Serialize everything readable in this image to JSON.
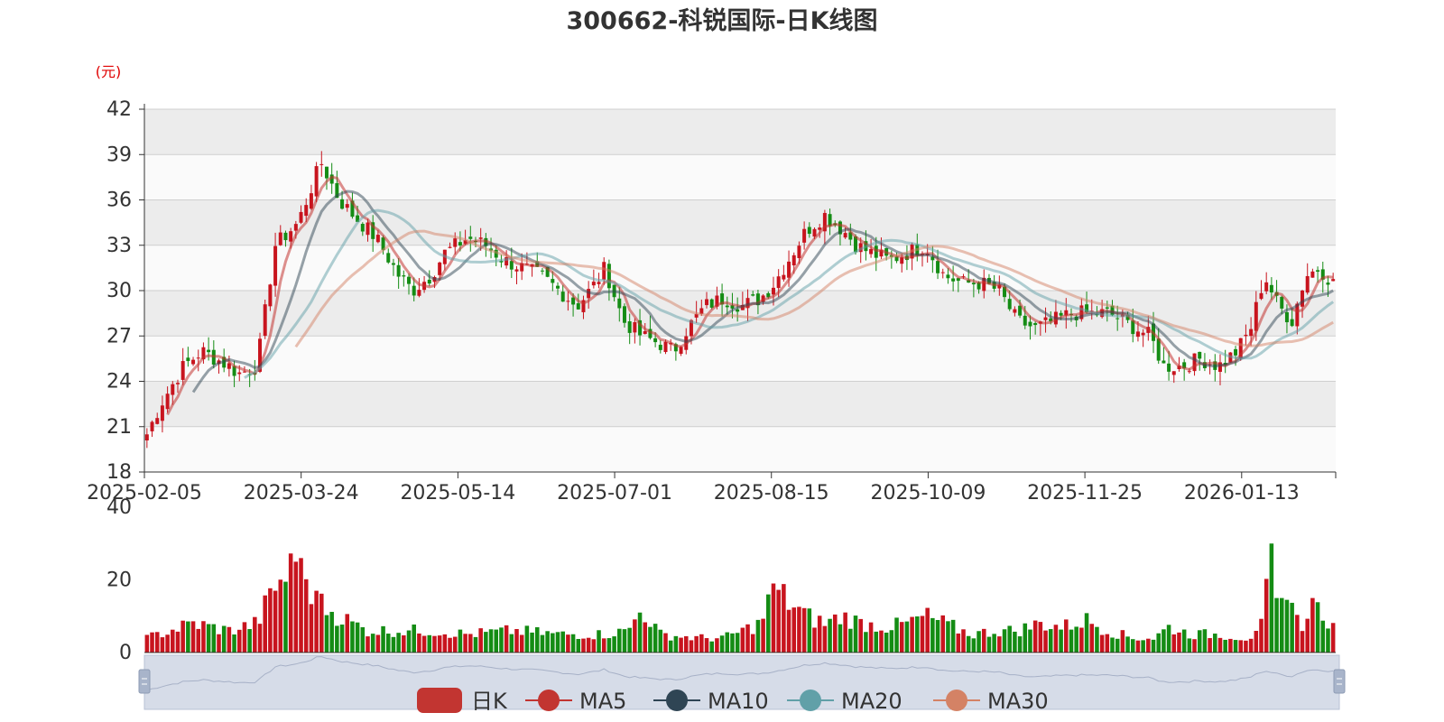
{
  "chart_data": {
    "type": "candlestick",
    "title": "300662-科锐国际-日K线图",
    "unit_label": "(元)",
    "price_axis": {
      "min": 18,
      "max": 42,
      "ticks": [
        18,
        21,
        24,
        27,
        30,
        33,
        36,
        39,
        42
      ]
    },
    "volume_axis": {
      "min": 0,
      "max": 40,
      "ticks": [
        0,
        20,
        40
      ]
    },
    "x_tick_labels": [
      "2025-02-05",
      "2025-03-24",
      "2025-05-14",
      "2025-07-01",
      "2025-08-15",
      "2025-10-09",
      "2025-11-25",
      "2026-01-13"
    ],
    "candle_count": 232,
    "price_keyframes": [
      [
        0,
        20.5
      ],
      [
        3,
        22.5
      ],
      [
        8,
        25.0
      ],
      [
        12,
        26.0
      ],
      [
        18,
        25.0
      ],
      [
        20,
        24.5
      ],
      [
        24,
        25.0
      ],
      [
        28,
        33.0
      ],
      [
        33,
        34.5
      ],
      [
        38,
        38.5
      ],
      [
        42,
        36.0
      ],
      [
        45,
        35.0
      ],
      [
        50,
        33.5
      ],
      [
        55,
        31.0
      ],
      [
        58,
        30.0
      ],
      [
        62,
        31.0
      ],
      [
        65,
        32.5
      ],
      [
        70,
        33.5
      ],
      [
        74,
        33.0
      ],
      [
        78,
        32.0
      ],
      [
        82,
        31.5
      ],
      [
        86,
        31.0
      ],
      [
        90,
        30.0
      ],
      [
        94,
        29.0
      ],
      [
        98,
        30.5
      ],
      [
        100,
        31.5
      ],
      [
        104,
        28.0
      ],
      [
        108,
        27.0
      ],
      [
        112,
        26.5
      ],
      [
        115,
        26.0
      ],
      [
        118,
        27.5
      ],
      [
        122,
        29.0
      ],
      [
        126,
        29.5
      ],
      [
        130,
        29.0
      ],
      [
        134,
        29.5
      ],
      [
        137,
        30.5
      ],
      [
        140,
        32.0
      ],
      [
        144,
        34.0
      ],
      [
        148,
        35.0
      ],
      [
        152,
        34.0
      ],
      [
        155,
        33.0
      ],
      [
        158,
        32.5
      ],
      [
        162,
        32.0
      ],
      [
        166,
        32.5
      ],
      [
        170,
        33.0
      ],
      [
        174,
        31.0
      ],
      [
        178,
        30.5
      ],
      [
        182,
        30.5
      ],
      [
        186,
        30.0
      ],
      [
        190,
        28.0
      ],
      [
        194,
        27.5
      ],
      [
        198,
        28.0
      ],
      [
        202,
        28.5
      ],
      [
        206,
        28.5
      ],
      [
        210,
        28.5
      ],
      [
        213,
        28.0
      ],
      [
        216,
        27.5
      ],
      [
        219,
        27.0
      ],
      [
        222,
        25.0
      ],
      [
        226,
        25.0
      ],
      [
        230,
        25.5
      ],
      [
        234,
        25.0
      ],
      [
        238,
        26.0
      ],
      [
        241,
        27.5
      ],
      [
        244,
        31.0
      ],
      [
        247,
        29.0
      ],
      [
        250,
        28.0
      ],
      [
        253,
        31.0
      ],
      [
        256,
        31.5
      ],
      [
        259,
        30.5
      ]
    ],
    "volume_keyframes": [
      [
        0,
        4
      ],
      [
        10,
        8
      ],
      [
        18,
        6
      ],
      [
        24,
        8
      ],
      [
        28,
        18
      ],
      [
        33,
        25
      ],
      [
        37,
        14
      ],
      [
        42,
        10
      ],
      [
        48,
        6
      ],
      [
        55,
        6
      ],
      [
        62,
        6
      ],
      [
        70,
        5
      ],
      [
        80,
        6
      ],
      [
        90,
        5
      ],
      [
        100,
        5
      ],
      [
        105,
        6
      ],
      [
        108,
        12
      ],
      [
        112,
        5
      ],
      [
        120,
        4
      ],
      [
        126,
        4
      ],
      [
        130,
        6
      ],
      [
        134,
        8
      ],
      [
        137,
        18
      ],
      [
        140,
        14
      ],
      [
        144,
        10
      ],
      [
        148,
        8
      ],
      [
        152,
        10
      ],
      [
        156,
        8
      ],
      [
        162,
        7
      ],
      [
        166,
        8
      ],
      [
        170,
        10
      ],
      [
        174,
        8
      ],
      [
        180,
        5
      ],
      [
        186,
        6
      ],
      [
        190,
        6
      ],
      [
        195,
        8
      ],
      [
        200,
        7
      ],
      [
        205,
        9
      ],
      [
        210,
        6
      ],
      [
        215,
        4
      ],
      [
        220,
        4
      ],
      [
        223,
        7
      ],
      [
        228,
        5
      ],
      [
        234,
        5
      ],
      [
        240,
        4
      ],
      [
        243,
        5
      ],
      [
        245,
        20
      ],
      [
        246,
        29
      ],
      [
        248,
        14
      ],
      [
        252,
        8
      ],
      [
        256,
        12
      ],
      [
        259,
        7
      ]
    ],
    "volume_spikes": [
      [
        33,
        25
      ],
      [
        34,
        26
      ],
      [
        37,
        17
      ],
      [
        108,
        11
      ],
      [
        137,
        19
      ],
      [
        245,
        20
      ],
      [
        246,
        30
      ],
      [
        247,
        15
      ],
      [
        248,
        15
      ],
      [
        255,
        15
      ]
    ],
    "legend": [
      {
        "name": "日K",
        "color": "#c23531"
      },
      {
        "name": "MA5",
        "color": "#c23531"
      },
      {
        "name": "MA10",
        "color": "#2f4554"
      },
      {
        "name": "MA20",
        "color": "#61a0a8"
      },
      {
        "name": "MA30",
        "color": "#d48265"
      }
    ],
    "colors": {
      "up": "#c8141e",
      "down": "#148c14",
      "plot_band_a": "#ececec",
      "plot_band_b": "#fafafa",
      "grid": "#cfcfcf",
      "slider_bg": "#d6dce8"
    }
  }
}
